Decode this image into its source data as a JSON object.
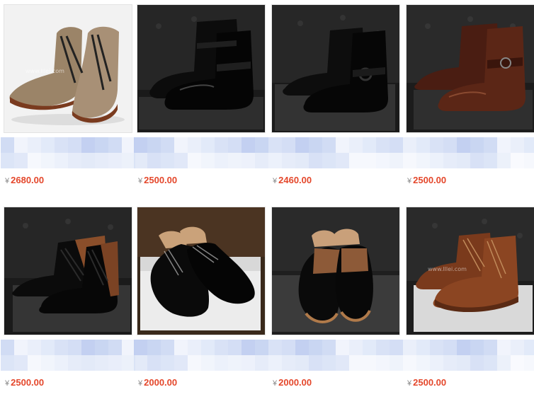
{
  "currency_symbol": "¥",
  "products": [
    {
      "price": "2680.00",
      "image": "brown-lace-up-brogue-boots-image"
    },
    {
      "price": "2500.00",
      "image": "black-engineer-boots-image"
    },
    {
      "price": "2460.00",
      "image": "black-strap-boots-image"
    },
    {
      "price": "2500.00",
      "image": "brown-engineer-boots-image"
    },
    {
      "price": "2500.00",
      "image": "black-brown-chukka-boots-image"
    },
    {
      "price": "2000.00",
      "image": "black-oxford-shoes-image"
    },
    {
      "price": "2000.00",
      "image": "black-brown-brogue-shoes-image"
    },
    {
      "price": "2500.00",
      "image": "brown-wingtip-boots-image"
    }
  ],
  "colors": {
    "price": "#e4472b",
    "blur": "#c9d6f2"
  }
}
